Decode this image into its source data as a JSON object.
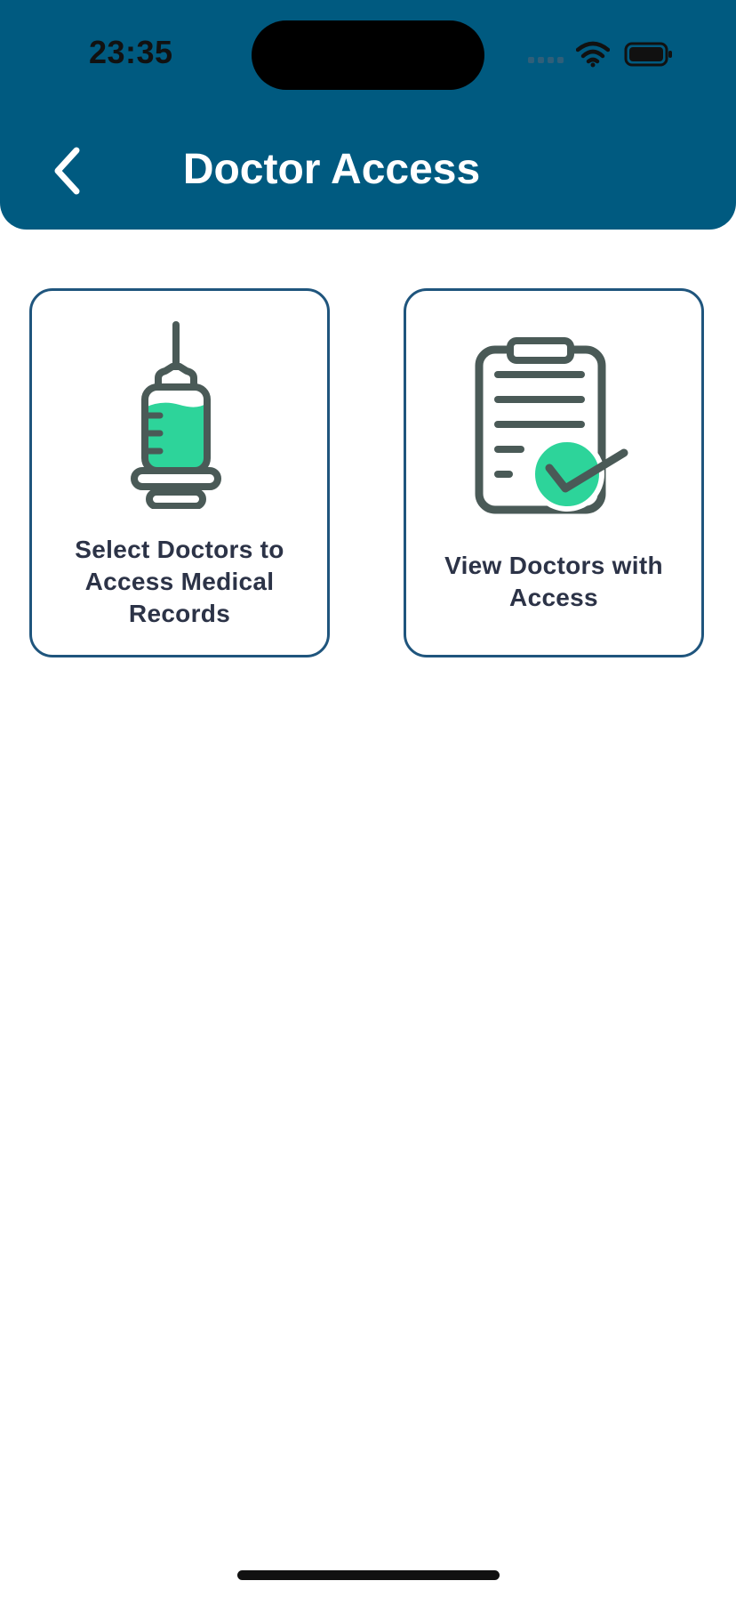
{
  "status_bar": {
    "time": "23:35"
  },
  "header": {
    "title": "Doctor Access",
    "back_icon": "chevron-left-icon",
    "background_color": "#005a80"
  },
  "cards": [
    {
      "label": "Select Doctors to Access Medical Records",
      "icon": "syringe-icon"
    },
    {
      "label": "View Doctors with Access",
      "icon": "clipboard-check-icon"
    }
  ],
  "colors": {
    "card_border": "#1f557d",
    "icon_stroke": "#4a5a57",
    "accent_green": "#2dd49a",
    "text_dark": "#2c3347"
  }
}
